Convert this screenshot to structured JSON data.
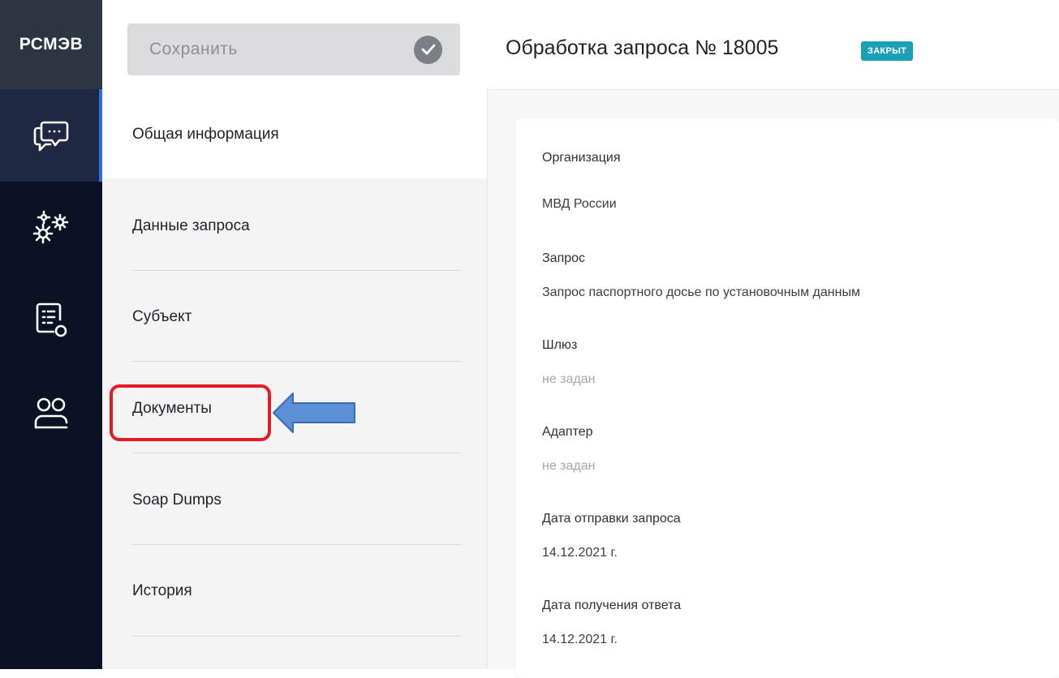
{
  "app": {
    "logo_text": "РСМЭВ"
  },
  "rail": {
    "items": [
      {
        "icon": "chat-icon",
        "active": true
      },
      {
        "icon": "gears-icon",
        "active": false
      },
      {
        "icon": "list-search-icon",
        "active": false
      },
      {
        "icon": "users-icon",
        "active": false
      }
    ]
  },
  "toolbar": {
    "save_label": "Сохранить",
    "save_icon": "check-circle-icon"
  },
  "header": {
    "title": "Обработка запроса № 18005",
    "status": "ЗАКРЫТ"
  },
  "sections": [
    {
      "label": "Общая информация",
      "active": true
    },
    {
      "label": "Данные запроса",
      "active": false
    },
    {
      "label": "Субъект",
      "active": false
    },
    {
      "label": "Документы",
      "active": false,
      "highlighted": true
    },
    {
      "label": "Soap Dumps",
      "active": false
    },
    {
      "label": "История",
      "active": false
    }
  ],
  "details": [
    {
      "label": "Организация",
      "value": "МВД России",
      "muted": false
    },
    {
      "label": "Запрос",
      "value": "Запрос паспортного досье по установочным данным",
      "muted": false
    },
    {
      "label": "Шлюз",
      "value": "не задан",
      "muted": true
    },
    {
      "label": "Адаптер",
      "value": "не задан",
      "muted": true
    },
    {
      "label": "Дата отправки запроса",
      "value": "14.12.2021 г.",
      "muted": false
    },
    {
      "label": "Дата получения ответа",
      "value": "14.12.2021 г.",
      "muted": false
    }
  ],
  "colors": {
    "rail_bg": "#0b1226",
    "accent": "#2f6fe0",
    "status_badge": "#1a9fb6",
    "highlight": "#e51c23",
    "arrow_fill": "#5b8fd6"
  }
}
